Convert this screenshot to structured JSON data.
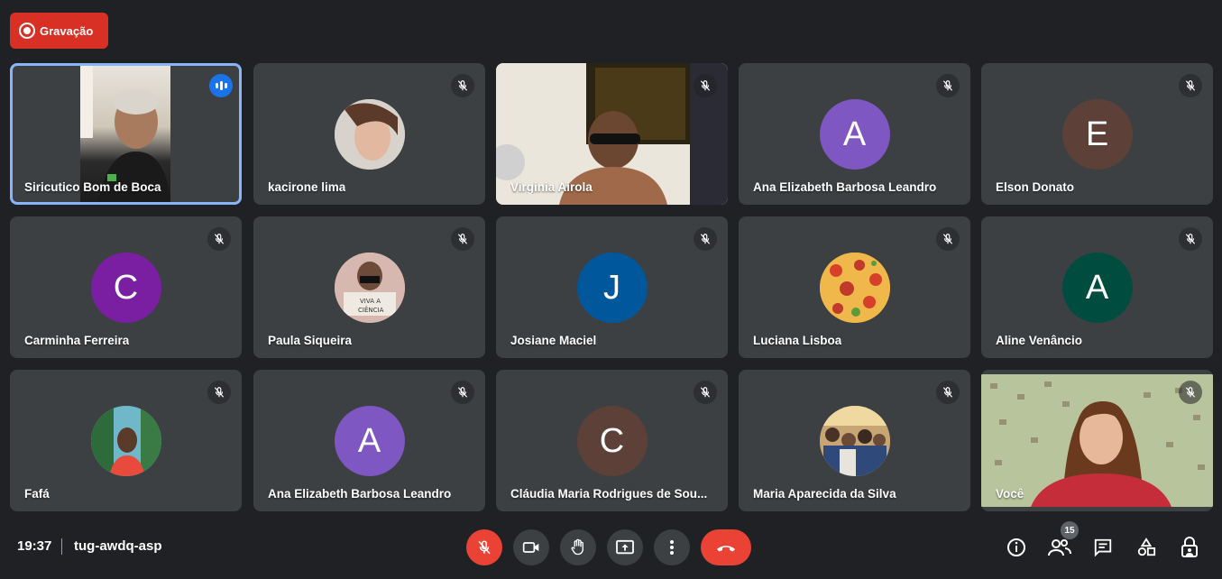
{
  "recording": {
    "label": "Gravação"
  },
  "tiles": [
    {
      "name": "Siricutico Bom de Boca",
      "type": "video",
      "speaking": true
    },
    {
      "name": "kacirone lima",
      "type": "photo",
      "muted": true
    },
    {
      "name": "Virginia Airola",
      "type": "video",
      "muted": true
    },
    {
      "name": "Ana Elizabeth Barbosa Leandro",
      "type": "initial",
      "initial": "A",
      "color": "#7e57c2",
      "muted": true
    },
    {
      "name": "Elson Donato",
      "type": "initial",
      "initial": "E",
      "color": "#5d4037",
      "muted": true
    },
    {
      "name": "Carminha Ferreira",
      "type": "initial",
      "initial": "C",
      "color": "#7b1fa2",
      "muted": true
    },
    {
      "name": "Paula Siqueira",
      "type": "photo",
      "muted": true
    },
    {
      "name": "Josiane Maciel",
      "type": "initial",
      "initial": "J",
      "color": "#01579b",
      "muted": true
    },
    {
      "name": "Luciana Lisboa",
      "type": "photo",
      "muted": true
    },
    {
      "name": "Aline Venâncio",
      "type": "initial",
      "initial": "A",
      "color": "#004d40",
      "muted": true
    },
    {
      "name": "Fafá",
      "type": "photo",
      "muted": true
    },
    {
      "name": "Ana Elizabeth Barbosa Leandro",
      "type": "initial",
      "initial": "A",
      "color": "#7e57c2",
      "muted": true
    },
    {
      "name": "Cláudia Maria Rodrigues de Sou...",
      "type": "initial",
      "initial": "C",
      "color": "#5d4037",
      "muted": true
    },
    {
      "name": "Maria Aparecida da Silva",
      "type": "photo",
      "muted": true
    },
    {
      "name": "Você",
      "type": "video",
      "muted": true
    }
  ],
  "bottom_bar": {
    "time": "19:37",
    "meeting_code": "tug-awdq-asp",
    "participant_count": "15"
  },
  "colors": {
    "background": "#202124",
    "tile": "#3c4043",
    "recording": "#d93025",
    "danger": "#ea4335",
    "accent": "#8ab4f8"
  }
}
